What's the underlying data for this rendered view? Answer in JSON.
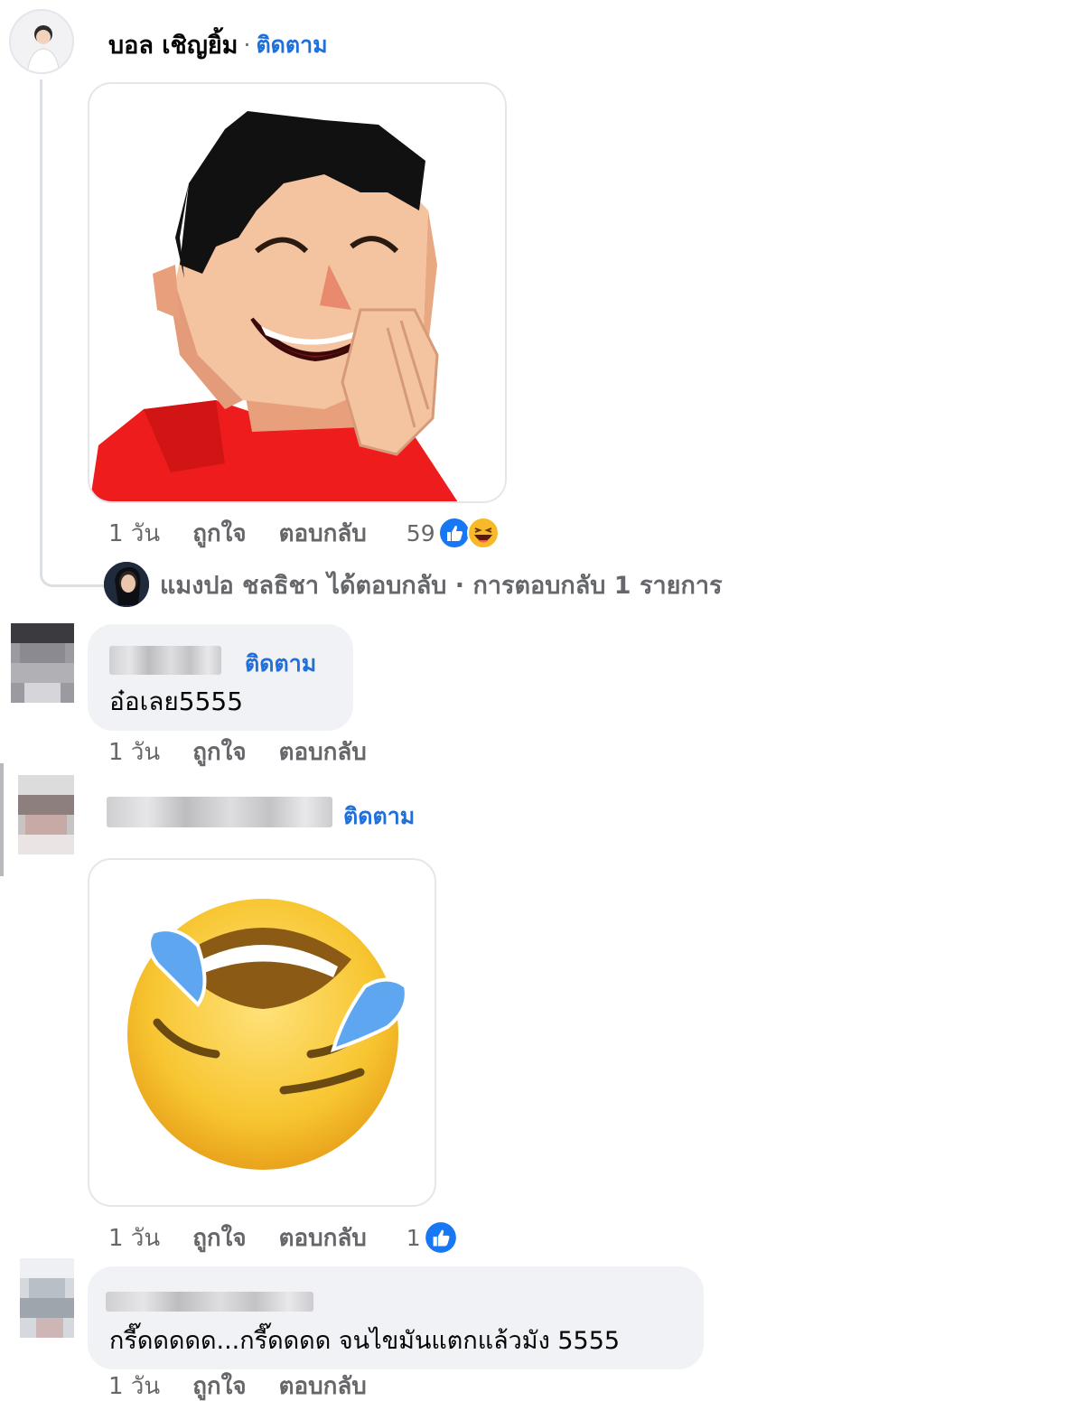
{
  "comments": [
    {
      "author": "บอล เชิญยิ้ม",
      "separator": "·",
      "follow_label": "ติดตาม",
      "time": "1 วัน",
      "like_label": "ถูกใจ",
      "reply_label": "ตอบกลับ",
      "reaction_count": "59",
      "reactions": [
        "like-icon",
        "haha-icon"
      ]
    },
    {
      "author": "",
      "follow_label": "ติดตาม",
      "text": "อ๋อเลย5555",
      "time": "1 วัน",
      "like_label": "ถูกใจ",
      "reply_label": "ตอบกลับ"
    },
    {
      "author": "",
      "follow_label": "ติดตาม",
      "time": "1 วัน",
      "like_label": "ถูกใจ",
      "reply_label": "ตอบกลับ",
      "reaction_count": "1",
      "reactions": [
        "like-icon"
      ]
    },
    {
      "author": "",
      "text": "กรี๊ดดดดด...กรี๊ดดดด จนไขมันแตกแล้วมัง 5555",
      "time": "1 วัน",
      "like_label": "ถูกใจ",
      "reply_label": "ตอบกลับ"
    }
  ],
  "reply_summary": {
    "text": "แมงปอ ชลธิชา ได้ตอบกลับ · การตอบกลับ 1 รายการ"
  },
  "colors": {
    "link_blue": "#216fdb",
    "meta_gray": "#65676b",
    "bubble_bg": "#f0f2f5",
    "like_blue": "#1877f2",
    "sticker_shirt": "#ee1c1c",
    "emoji_yellow": "#f7c530"
  }
}
